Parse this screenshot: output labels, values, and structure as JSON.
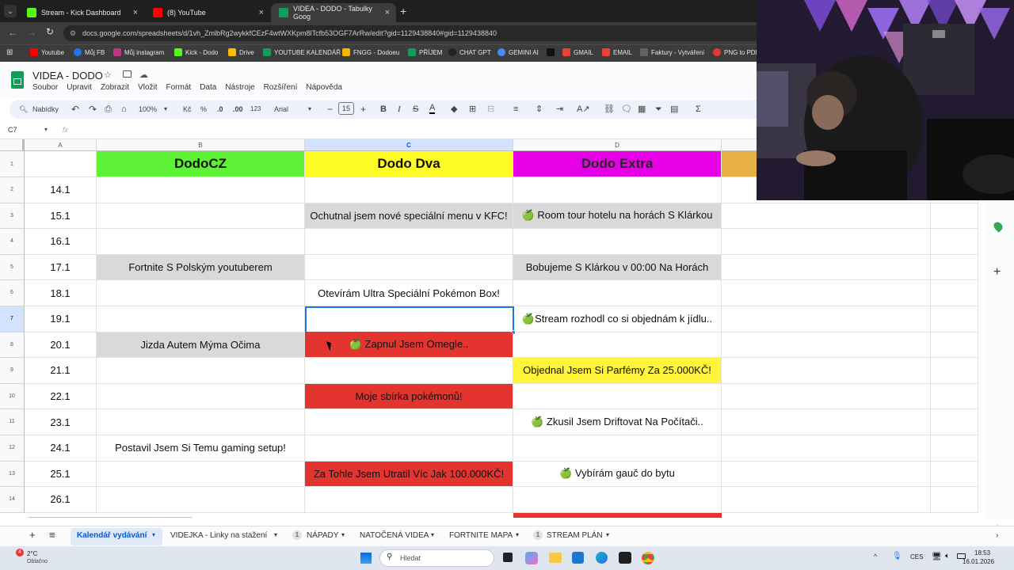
{
  "browser": {
    "tabs": [
      {
        "label": "Stream - Kick Dashboard",
        "favicon_color": "#53fc18"
      },
      {
        "label": "(8) YouTube",
        "favicon_color": "#ff0000"
      },
      {
        "label": "VIDEA - DODO - Tabulky Goog",
        "favicon_color": "#0f9d58"
      }
    ],
    "url": "docs.google.com/spreadsheets/d/1vh_ZmlbRg2wykkfCEzF4wtWXKpm8lTcfb53OGF7ArRw/edit?gid=1129438840#gid=1129438840",
    "bookmarks": [
      {
        "label": "Youtube",
        "color": "#ff0000"
      },
      {
        "label": "Můj FB",
        "color": "#1877f2"
      },
      {
        "label": "Můj instagram",
        "color": "#c13584"
      },
      {
        "label": "Kick - Dodo",
        "color": "#53fc18"
      },
      {
        "label": "Drive",
        "color": "#fbbc04"
      },
      {
        "label": "YOUTUBE KALENDÁŘ",
        "color": "#0f9d58"
      },
      {
        "label": "FNGG - Dodoeu",
        "color": "#f5b400"
      },
      {
        "label": "PŘÍJEM",
        "color": "#0f9d58"
      },
      {
        "label": "CHAT GPT",
        "color": "#222222"
      },
      {
        "label": "GEMINI AI",
        "color": "#4a8af4"
      },
      {
        "label": "GMAIL",
        "color": "#ea4335"
      },
      {
        "label": "EMAIL",
        "color": "#ea4335"
      },
      {
        "label": "Faktury - Vytváření",
        "color": "#5f6368"
      },
      {
        "label": "PNG to PDF",
        "color": "#e53935"
      }
    ]
  },
  "doc": {
    "title": "VIDEA - DODO",
    "menu": [
      "Soubor",
      "Upravit",
      "Zobrazit",
      "Vložit",
      "Formát",
      "Data",
      "Nástroje",
      "Rozšíření",
      "Nápověda"
    ]
  },
  "toolbar": {
    "search_label": "Nabídky",
    "zoom": "100%",
    "currency": "Kč",
    "percent": "%",
    "dec_less": ".0",
    "dec_more": ".00",
    "number_format": "123",
    "font": "Arial",
    "font_size": "15"
  },
  "formula": {
    "cell_ref": "C7",
    "fx": "fx"
  },
  "grid": {
    "columns": [
      "A",
      "B",
      "C",
      "D"
    ],
    "rows": [
      {
        "num": "1",
        "a": "",
        "b": "DodoCZ",
        "c": "Dodo Dva",
        "d": "Dodo Extra"
      },
      {
        "num": "2",
        "a": "14.1",
        "b": "",
        "c": "",
        "d": ""
      },
      {
        "num": "3",
        "a": "15.1",
        "b": "",
        "c": "Ochutnal jsem nové speciální menu v KFC!",
        "d": "🍏 Room tour hotelu na horách S Klárkou"
      },
      {
        "num": "4",
        "a": "16.1",
        "b": "",
        "c": "",
        "d": ""
      },
      {
        "num": "5",
        "a": "17.1",
        "b": "Fortnite S Polským youtuberem",
        "c": "",
        "d": "Bobujeme S Klárkou v 00:00 Na Horách"
      },
      {
        "num": "6",
        "a": "18.1",
        "b": "",
        "c": "Otevírám Ultra Speciální Pokémon Box!",
        "d": ""
      },
      {
        "num": "7",
        "a": "19.1",
        "b": "",
        "c": "",
        "d": "🍏Stream rozhodl co si objednám k jídlu.."
      },
      {
        "num": "8",
        "a": "20.1",
        "b": "Jizda Autem Mýma Očima",
        "c": "🍏 Zapnul Jsem Omegle..",
        "d": ""
      },
      {
        "num": "9",
        "a": "21.1",
        "b": "",
        "c": "",
        "d": "Objednal Jsem Si Parfémy Za 25.000KČ!"
      },
      {
        "num": "10",
        "a": "22.1",
        "b": "",
        "c": "Moje sbírka pokémonů!",
        "d": ""
      },
      {
        "num": "11",
        "a": "23.1",
        "b": "",
        "c": "",
        "d": "🍏 Zkusil Jsem Driftovat Na Počítači.."
      },
      {
        "num": "12",
        "a": "24.1",
        "b": "Postavil Jsem Si Temu gaming setup!",
        "c": "",
        "d": ""
      },
      {
        "num": "13",
        "a": "25.1",
        "b": "",
        "c": "Za Tohle Jsem Utratil Víc Jak 100.000KČ!",
        "d": "🍏 Vybírám gauč do bytu"
      },
      {
        "num": "14",
        "a": "26.1",
        "b": "",
        "c": "",
        "d": ""
      }
    ],
    "colors": {
      "dodocz_header": "#5ef236",
      "dododva_header": "#fffb26",
      "dodoextra_header": "#e600e6",
      "extra_header": "#e6b142",
      "gray": "#d9d9d9",
      "red": "#e3342f",
      "yellow": "#fff33b",
      "selection": "#1a73e8"
    }
  },
  "sheets": {
    "add": "+",
    "all": "≡",
    "tabs": [
      {
        "label": "Kalendář vydávání",
        "badge": ""
      },
      {
        "label": "VIDEJKA - Linky na stažení",
        "badge": ""
      },
      {
        "label": "NÁPADY",
        "badge": "1"
      },
      {
        "label": "NATOČENÁ VIDEA",
        "badge": ""
      },
      {
        "label": "FORTNITE MAPA",
        "badge": ""
      },
      {
        "label": "STREAM PLÁN",
        "badge": "1"
      }
    ]
  },
  "taskbar": {
    "weather_temp": "2°C",
    "weather_text": "Oblačno",
    "weather_badge": "4",
    "search": "Hledat",
    "lang": "CES",
    "time": "18:53",
    "date": "16.01.2026"
  }
}
